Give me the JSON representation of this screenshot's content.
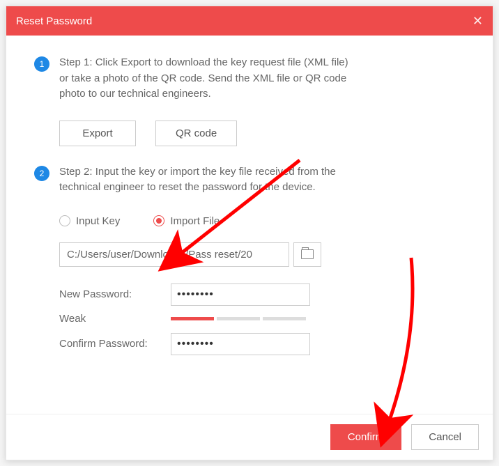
{
  "colors": {
    "accent": "#ee4b4b",
    "step_badge": "#1e88e5"
  },
  "titlebar": {
    "title": "Reset Password"
  },
  "step1": {
    "num": "1",
    "text": "Step 1: Click Export to download the key request file (XML file) or take a photo of the QR code. Send the XML file or QR code photo to our technical engineers.",
    "export_label": "Export",
    "qr_label": "QR code"
  },
  "step2": {
    "num": "2",
    "text": "Step 2: Input the key or import the key file received from the technical engineer to reset the password for the device.",
    "radio_input_key": "Input Key",
    "radio_import_file": "Import File",
    "selected_radio": "import_file",
    "file_path": "C:/Users/user/Downloads/Pass reset/20",
    "new_password_label": "New Password:",
    "new_password_value": "••••••••",
    "strength_label": "Weak",
    "strength_filled_bars": 1,
    "strength_total_bars": 3,
    "confirm_password_label": "Confirm Password:",
    "confirm_password_value": "••••••••"
  },
  "footer": {
    "confirm_label": "Confirm",
    "cancel_label": "Cancel"
  }
}
